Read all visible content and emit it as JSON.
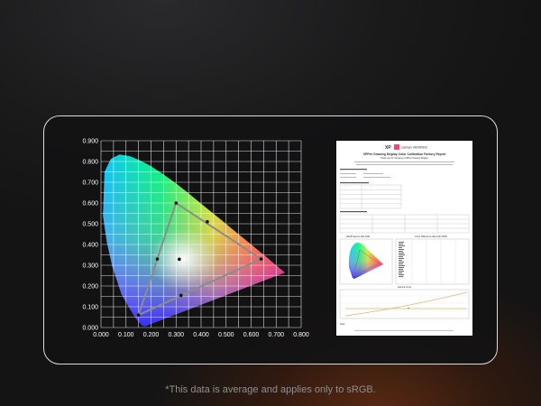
{
  "chart_data": {
    "type": "scatter",
    "title": "",
    "xlabel": "",
    "ylabel": "",
    "xlim": [
      0.0,
      0.8
    ],
    "ylim": [
      0.0,
      0.9
    ],
    "x_ticks": [
      "0.000",
      "0.100",
      "0.200",
      "0.300",
      "0.400",
      "0.500",
      "0.600",
      "0.700",
      "0.800"
    ],
    "y_ticks": [
      "0.000",
      "0.100",
      "0.200",
      "0.300",
      "0.400",
      "0.500",
      "0.600",
      "0.700",
      "0.800",
      "0.900"
    ],
    "grid": true,
    "gamut_triangle": [
      {
        "x": 0.64,
        "y": 0.33
      },
      {
        "x": 0.3,
        "y": 0.6
      },
      {
        "x": 0.15,
        "y": 0.06
      }
    ],
    "points": [
      {
        "x": 0.64,
        "y": 0.33
      },
      {
        "x": 0.3,
        "y": 0.6
      },
      {
        "x": 0.15,
        "y": 0.06
      },
      {
        "x": 0.225,
        "y": 0.33
      },
      {
        "x": 0.425,
        "y": 0.51
      },
      {
        "x": 0.32,
        "y": 0.155
      },
      {
        "x": 0.313,
        "y": 0.329
      }
    ],
    "colors": {
      "triangle": "#8c8c8c",
      "points": "#111111",
      "grid": "#ffffff"
    }
  },
  "report": {
    "logos": [
      "XP",
      "calman VERIFIED"
    ],
    "title": "XPPen Drawing Display Color Calibration Factory Report",
    "subtitle": "Thank you for choosing a XPPen Drawing Display.",
    "chart_title_left": "sRGB Gamut CIE 1931",
    "chart_title_right": "Color Difference ΔE (CIE 2000)",
    "bottom_chart_title": "Gamma Curve",
    "note_label": "Note"
  },
  "footnote": "*This data is average and applies only to sRGB."
}
